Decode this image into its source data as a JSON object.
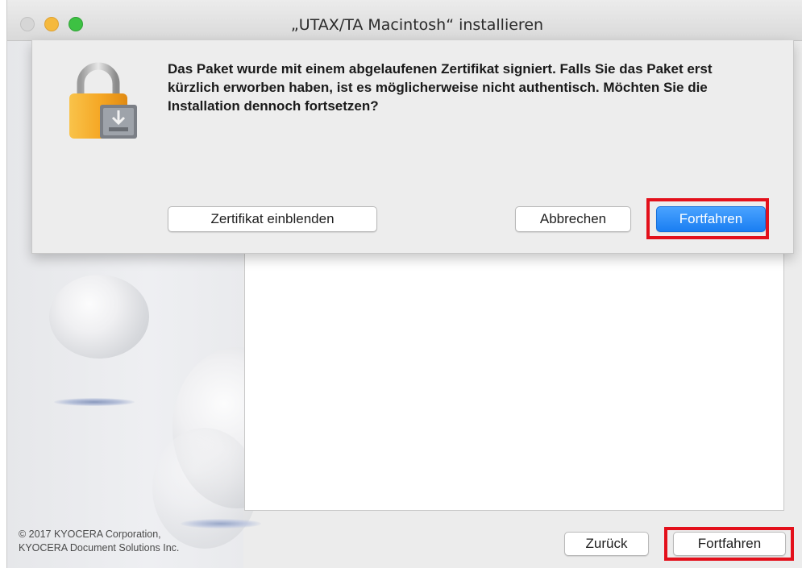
{
  "window": {
    "title": "„UTAX/TA Macintosh“ installieren"
  },
  "dialog": {
    "message": "Das Paket wurde mit einem abgelaufenen Zertifikat signiert. Falls Sie das Paket erst kürzlich erworben haben, ist es möglicherweise nicht authentisch. Möchten Sie die Installation dennoch fortsetzen?",
    "show_certificate_label": "Zertifikat einblenden",
    "cancel_label": "Abbrechen",
    "continue_label": "Fortfahren",
    "icon": "lock-package-icon"
  },
  "footer": {
    "copyright_line1": "© 2017 KYOCERA Corporation,",
    "copyright_line2": "KYOCERA Document Solutions Inc.",
    "back_label": "Zurück",
    "continue_label": "Fortfahren"
  },
  "colors": {
    "highlight": "#e3101b",
    "primary_button": "#1a7ef2",
    "lock_body": "#f5a623"
  }
}
